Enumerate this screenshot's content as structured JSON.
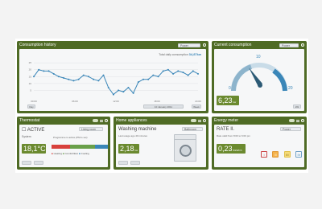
{
  "panels": {
    "consumption_history": {
      "title": "Consumption history",
      "dropdown": "Power",
      "total_label": "Total daily consumption",
      "total_value": "34,87kw",
      "date": "10 January 2011",
      "left_button": "Day",
      "right_button": "Week"
    },
    "current_consumption": {
      "title": "Current consumption",
      "dropdown": "Power",
      "value": "6,23",
      "unit": "kw",
      "dial_min": "0",
      "dial_mid": "10",
      "dial_max": "20",
      "button": "kW"
    },
    "thermostat": {
      "title": "Thermostat",
      "status": "ACTIVE",
      "dropdown": "Living room",
      "sub": "System",
      "note": "Programme is active (PM is set)",
      "value": "18,1°C",
      "legend": [
        "Heating",
        "Comfort/Eco",
        "Cooling"
      ]
    },
    "home_appliances": {
      "title": "Home appliances",
      "appliance": "Washing machine",
      "dropdown": "Bathroom",
      "note": "Last usage ago 40 minutes",
      "value": "2,18",
      "unit": "kw"
    },
    "energy_meter": {
      "title": "Energy meter",
      "rate": "RATE II.",
      "dropdown": "Power",
      "note": "Rate valid from 8:00 to 6:00 pm",
      "value": "0,23",
      "unit": "€/kWh/h",
      "rates": [
        "I",
        "II",
        "III",
        "IV"
      ]
    }
  },
  "chart_data": {
    "type": "line",
    "x_ticks": [
      "00:00",
      "06:00",
      "12:00",
      "18:00",
      "24:00"
    ],
    "y_ticks": [
      "5",
      "10",
      "15",
      "20",
      "25"
    ],
    "ylim": [
      0,
      28
    ],
    "values": [
      15,
      20,
      19,
      19,
      17,
      15,
      14,
      13,
      12,
      13,
      16,
      15,
      13,
      12,
      16,
      7,
      2,
      5,
      4,
      7,
      3,
      11,
      13,
      13,
      16,
      15,
      19,
      20,
      17,
      19,
      18,
      16,
      19,
      17
    ]
  },
  "colors": {
    "panel": "#4f6b25",
    "line": "#3a86b8"
  }
}
